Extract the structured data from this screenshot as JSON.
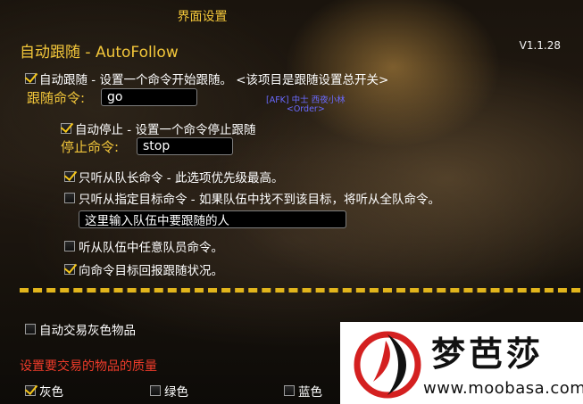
{
  "window": {
    "title": "界面设置"
  },
  "header": {
    "section_title": "自动跟随 - AutoFollow",
    "version": "V1.1.28"
  },
  "follow": {
    "master_label": "自动跟随 - 设置一个命令开始跟随。 <该项目是跟随设置总开关>",
    "master_checked": true,
    "command_label": "跟随命令:",
    "command_value": "go"
  },
  "overlay": {
    "afk_line1": "[AFK] 中士 西夜小林",
    "afk_line2": "<Order>"
  },
  "auto_stop": {
    "label": "自动停止 - 设置一个命令停止跟随",
    "checked": true,
    "command_label": "停止命令:",
    "command_value": "stop"
  },
  "options": {
    "leader_only": {
      "label": "只听从队长命令 - 此选项优先级最高。",
      "checked": true
    },
    "target_only": {
      "label": "只听从指定目标命令 - 如果队伍中找不到该目标，将听从全队命令。",
      "checked": false
    },
    "target_input_value": "这里输入队伍中要跟随的人",
    "any_member": {
      "label": "听从队伍中任意队员命令。",
      "checked": false
    },
    "report_status": {
      "label": "向命令目标回报跟随状况。",
      "checked": true
    }
  },
  "trade": {
    "auto_trade_gray": {
      "label": "自动交易灰色物品",
      "checked": false
    },
    "quality_title": "设置要交易的物品的质量",
    "qualities": [
      {
        "label": "灰色",
        "checked": true
      },
      {
        "label": "绿色",
        "checked": false
      },
      {
        "label": "蓝色",
        "checked": false
      }
    ]
  },
  "watermark": {
    "name": "梦芭莎",
    "url": "www.moobasa.com"
  },
  "colors": {
    "gold": "#f2c63a",
    "red": "#ee3b2a",
    "afk_blue": "#6a6aff"
  }
}
